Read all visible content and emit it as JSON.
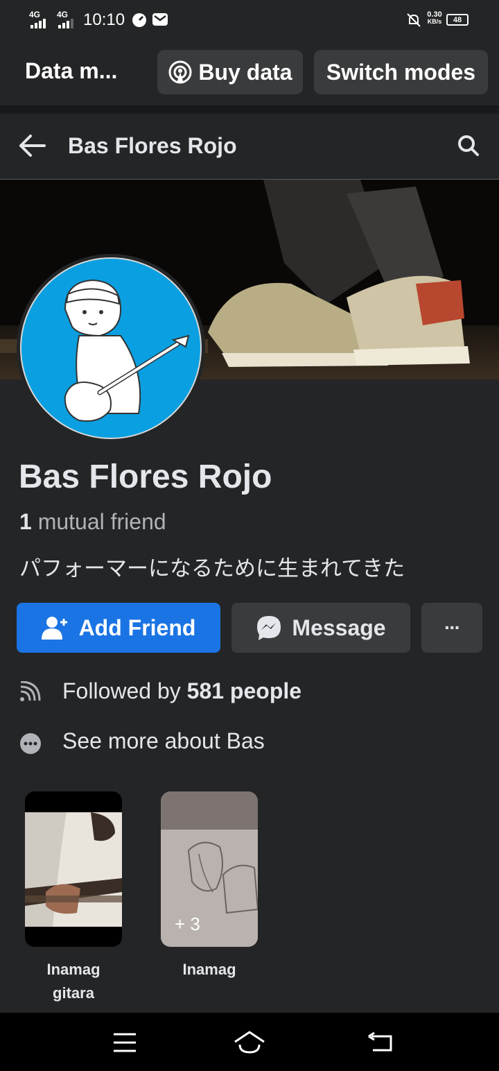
{
  "status_bar": {
    "network1": "4G",
    "network2": "4G",
    "time": "10:10",
    "speed_value": "0.30",
    "speed_unit": "KB/s",
    "battery": "48"
  },
  "data_bar": {
    "title": "Data m...",
    "buy_data_label": "Buy data",
    "switch_modes_label": "Switch modes"
  },
  "header": {
    "title": "Bas Flores Rojo"
  },
  "profile": {
    "name": "Bas Flores Rojo",
    "mutual_count": "1",
    "mutual_label": "mutual friend",
    "bio": "パフォーマーになるために生まれてきた"
  },
  "actions": {
    "add_friend_label": "Add Friend",
    "message_label": "Message",
    "more_label": "···"
  },
  "info": {
    "followed_prefix": "Followed by",
    "followed_count": "581 people",
    "see_more": "See more about Bas"
  },
  "highlights": [
    {
      "title_line1": "Inamag",
      "title_line2": "gitara",
      "overlay": ""
    },
    {
      "title_line1": "Inamag",
      "title_line2": "",
      "overlay": "+ 3"
    }
  ],
  "colors": {
    "accent": "#1b74e4",
    "background": "#242526",
    "button_secondary": "#3a3b3c",
    "avatar_bg": "#0a9fe0"
  }
}
